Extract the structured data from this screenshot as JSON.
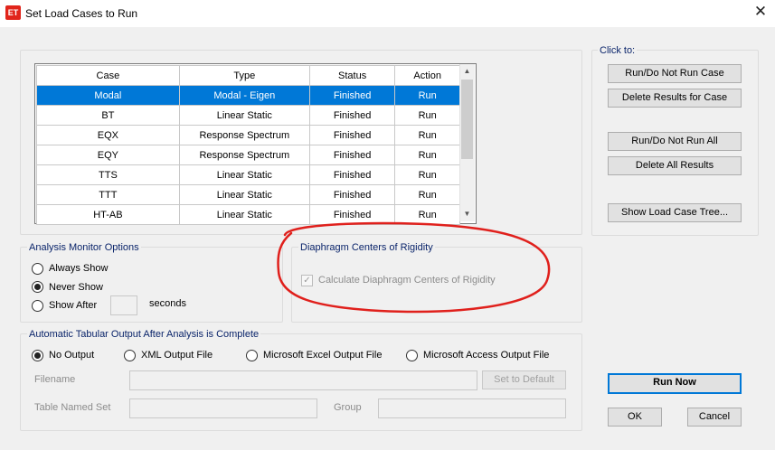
{
  "window": {
    "app_icon": "ET",
    "title": "Set Load Cases to Run",
    "close_glyph": "✕"
  },
  "table": {
    "headers": [
      "Case",
      "Type",
      "Status",
      "Action"
    ],
    "rows": [
      [
        "Modal",
        "Modal - Eigen",
        "Finished",
        "Run"
      ],
      [
        "BT",
        "Linear Static",
        "Finished",
        "Run"
      ],
      [
        "EQX",
        "Response Spectrum",
        "Finished",
        "Run"
      ],
      [
        "EQY",
        "Response Spectrum",
        "Finished",
        "Run"
      ],
      [
        "TTS",
        "Linear Static",
        "Finished",
        "Run"
      ],
      [
        "TTT",
        "Linear Static",
        "Finished",
        "Run"
      ],
      [
        "HT-AB",
        "Linear Static",
        "Finished",
        "Run"
      ]
    ],
    "selected_row": 0,
    "selection_color": "#0078d7",
    "scroll_up": "▲",
    "scroll_down": "▼"
  },
  "click_to": {
    "label": "Click to:",
    "run_do_not_run_case": "Run/Do Not Run Case",
    "delete_results_for_case": "Delete Results for Case",
    "run_do_not_run_all": "Run/Do Not Run All",
    "delete_all_results": "Delete All Results",
    "show_load_case_tree": "Show Load Case Tree..."
  },
  "analysis_monitor": {
    "label": "Analysis Monitor Options",
    "always_show": "Always Show",
    "never_show": "Never Show",
    "show_after": "Show After",
    "seconds": "seconds",
    "selected": "Never Show"
  },
  "diaphragm": {
    "label": "Diaphragm Centers of Rigidity",
    "checkbox_label": "Calculate Diaphragm Centers of Rigidity",
    "checked": true,
    "check_glyph": "✓"
  },
  "tabular_output": {
    "label": "Automatic Tabular Output After Analysis is Complete",
    "no_output": "No Output",
    "xml_output_file": "XML Output File",
    "excel_output_file": "Microsoft Excel Output File",
    "access_output_file": "Microsoft Access Output File",
    "selected": "No Output",
    "filename_label": "Filename",
    "set_to_default": "Set to Default",
    "table_named_set_label": "Table Named Set",
    "group_label": "Group"
  },
  "buttons": {
    "run_now": "Run Now",
    "ok": "OK",
    "cancel": "Cancel"
  },
  "annotation": {
    "circle_color": "#e0201c"
  }
}
